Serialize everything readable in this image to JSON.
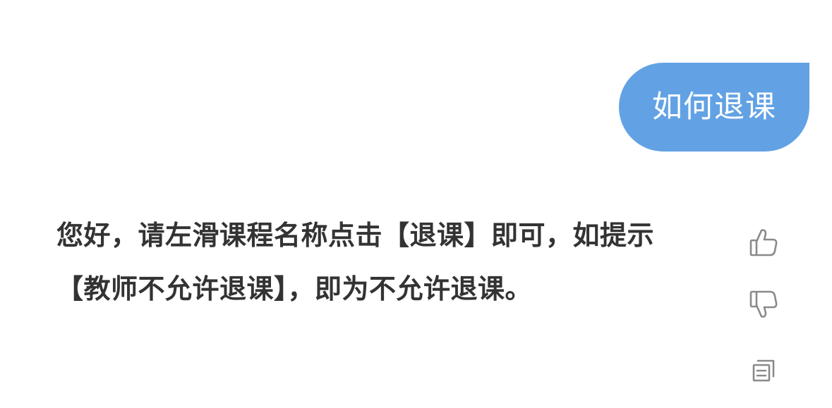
{
  "conversation": {
    "user_message": {
      "text": "如何退课",
      "bubble_color": "#62a2e4"
    },
    "bot_message": {
      "text": "您好，请左滑课程名称点击【退课】即可，如提示【教师不允许退课】，即为不允许退课。",
      "text_color": "#333333"
    }
  },
  "actions": {
    "icon_color": "#8a8a8a",
    "items": [
      {
        "name": "like",
        "icon": "thumbs-up-icon"
      },
      {
        "name": "dislike",
        "icon": "thumbs-down-icon"
      },
      {
        "name": "copy",
        "icon": "copy-icon"
      }
    ]
  }
}
